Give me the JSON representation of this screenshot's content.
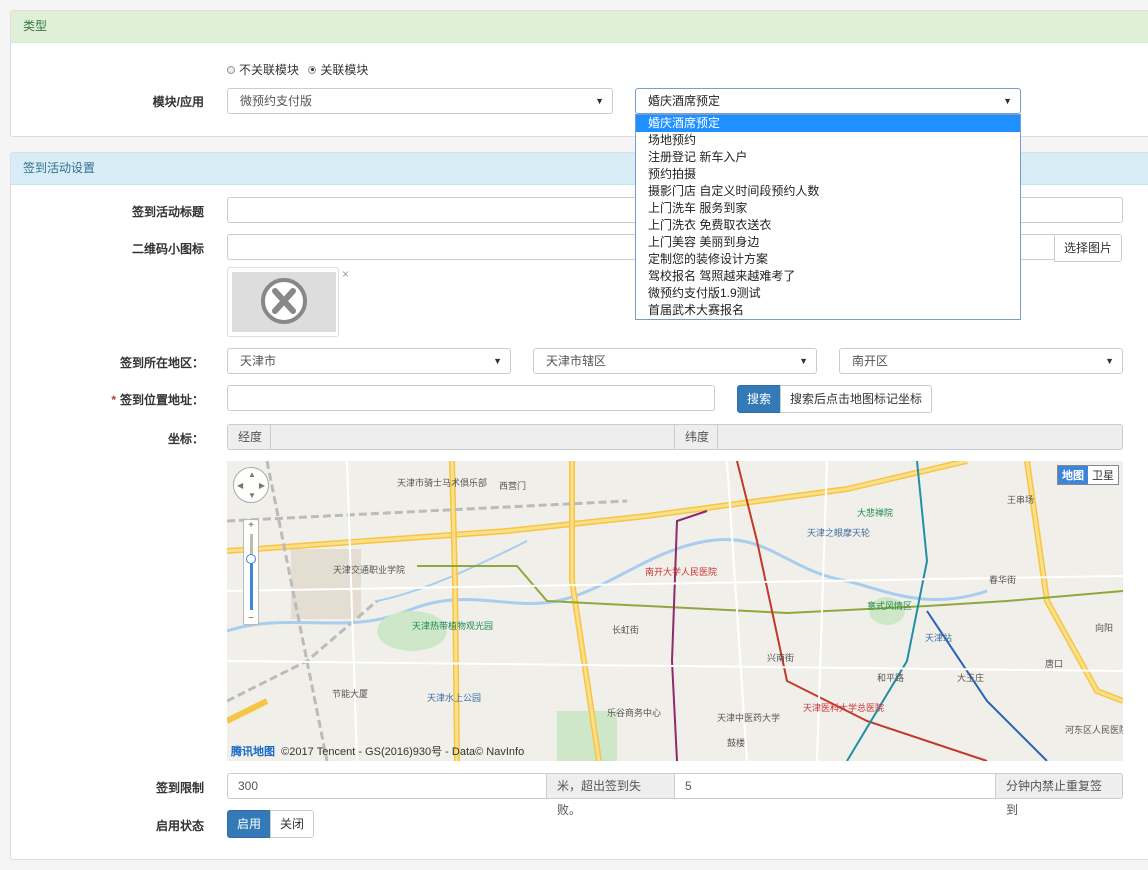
{
  "type_panel": {
    "heading": "类型",
    "radio_unlinked": "不关联模块",
    "radio_linked": "关联模块",
    "module_label": "模块/应用",
    "module_select": "微预约支付版",
    "app_select": "婚庆酒席预定",
    "app_options": [
      "婚庆酒席预定",
      "场地预约",
      "注册登记 新车入户",
      "预约拍摄",
      "摄影门店 自定义时间段预约人数",
      "上门洗车 服务到家",
      "上门洗衣 免费取衣送衣",
      "上门美容 美丽到身边",
      "定制您的装修设计方案",
      "驾校报名 驾照越来越难考了",
      "微预约支付版1.9测试",
      "首届武术大赛报名"
    ]
  },
  "sign_panel": {
    "heading": "签到活动设置",
    "title_label": "签到活动标题",
    "title_value": "",
    "icon_label": "二维码小图标",
    "icon_value": "",
    "choose_image": "选择图片",
    "close_mark": "×",
    "region_label": "签到所在地区：",
    "province": "天津市",
    "city": "天津市辖区",
    "district": "南开区",
    "required_mark": "*",
    "address_label": "签到位置地址：",
    "address_value": "",
    "search_button": "搜索",
    "search_hint": "搜索后点击地图标记坐标",
    "coord_label": "坐标：",
    "lng_label": "经度",
    "lng_value": "",
    "lat_label": "纬度",
    "lat_value": "",
    "map": {
      "type_map": "地图",
      "type_satellite": "卫星",
      "logo": "腾讯地图",
      "credit": "©2017 Tencent - GS(2016)930号 - Data© NavInfo",
      "places": {
        "p1": "天津市骑士马术俱乐部",
        "p2": "西营门",
        "p3": "天津交通职业学院",
        "p4": "天津水上公园",
        "p5": "天津热带植物观光园",
        "p6": "长虹街",
        "p7": "南开大学人民医院",
        "p8": "天津之眼摩天轮",
        "p9": "大悲禅院",
        "p10": "王串场",
        "p11": "春华街",
        "p12": "天津站",
        "p13": "兴南街",
        "p14": "天津中医药大学",
        "p15": "天津医科大学总医院",
        "p16": "大王庄",
        "p17": "节能大厦",
        "p18": "乐谷商务中心",
        "p19": "鼓楼",
        "p20": "向阳",
        "p21": "唐口",
        "p22": "河东区人民医院",
        "p23": "和平路",
        "p24": "意式风情区"
      }
    },
    "limit_label": "签到限制",
    "limit_distance": "300",
    "limit_distance_suffix": "米，超出签到失败。",
    "limit_minutes": "5",
    "limit_minutes_suffix": "分钟内禁止重复签到",
    "status_label": "启用状态",
    "status_on": "启用",
    "status_off": "关闭"
  },
  "colors": {
    "success_heading_bg": "#dff0d8",
    "info_heading_bg": "#d9edf7",
    "primary": "#337ab7",
    "dropdown_selected": "#1e90ff"
  }
}
